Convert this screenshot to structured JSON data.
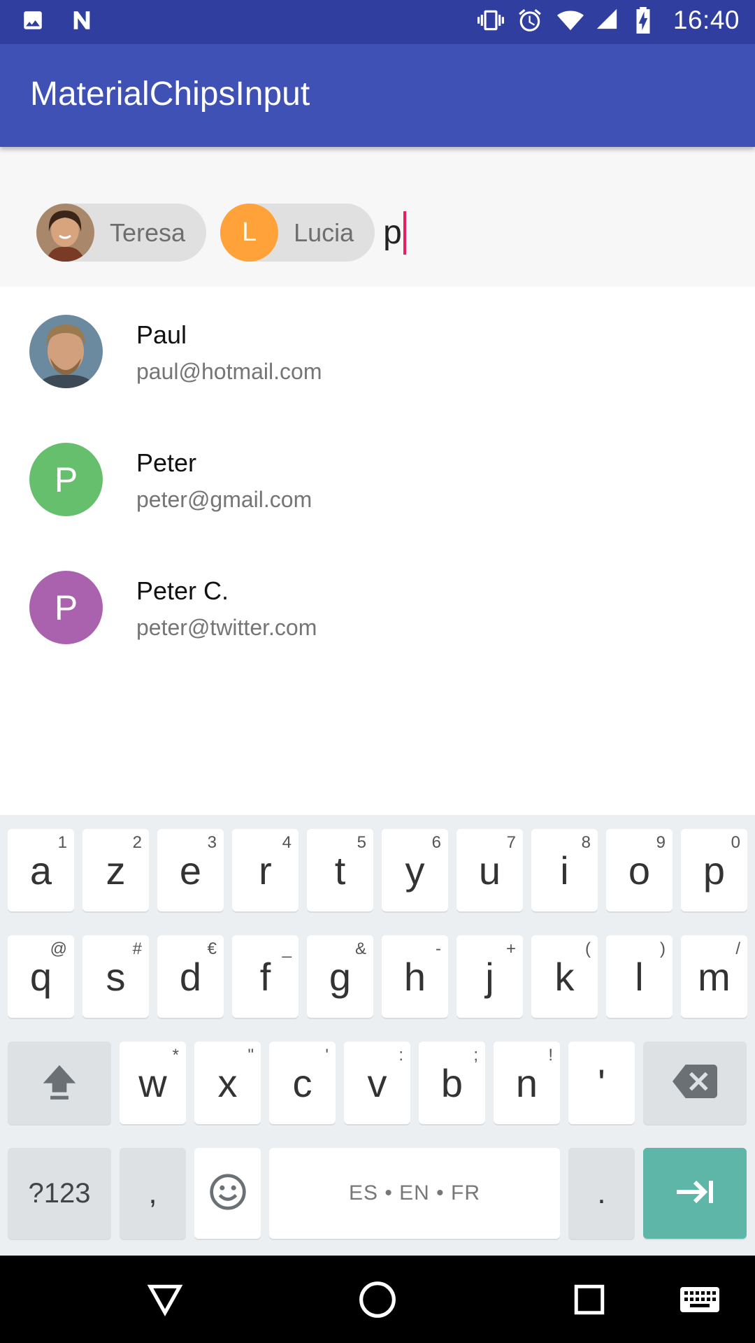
{
  "status_bar": {
    "time": "16:40",
    "left_icons": [
      "image-icon",
      "n-notification-icon"
    ],
    "right_icons": [
      "vibrate-icon",
      "alarm-icon",
      "wifi-icon",
      "signal-icon",
      "battery-charging-icon"
    ]
  },
  "app_bar": {
    "title": "MaterialChipsInput",
    "color": "#3f51b5",
    "status_color": "#303f9f"
  },
  "chips_input": {
    "chips": [
      {
        "label": "Teresa",
        "avatar": "photo"
      },
      {
        "label": "Lucia",
        "avatar_letter": "L",
        "avatar_color": "#ffa23a"
      }
    ],
    "typed_text": "p",
    "caret_color": "#e91e63"
  },
  "suggestions": [
    {
      "name": "Paul",
      "email": "paul@hotmail.com",
      "avatar": "photo"
    },
    {
      "name": "Peter",
      "email": "peter@gmail.com",
      "avatar_letter": "P",
      "avatar_color": "#66bf6d"
    },
    {
      "name": "Peter C.",
      "email": "peter@twitter.com",
      "avatar_letter": "P",
      "avatar_color": "#ab62ae"
    }
  ],
  "keyboard": {
    "row1": [
      {
        "k": "a",
        "h": "1"
      },
      {
        "k": "z",
        "h": "2"
      },
      {
        "k": "e",
        "h": "3"
      },
      {
        "k": "r",
        "h": "4"
      },
      {
        "k": "t",
        "h": "5"
      },
      {
        "k": "y",
        "h": "6"
      },
      {
        "k": "u",
        "h": "7"
      },
      {
        "k": "i",
        "h": "8"
      },
      {
        "k": "o",
        "h": "9"
      },
      {
        "k": "p",
        "h": "0"
      }
    ],
    "row2": [
      {
        "k": "q",
        "h": "@"
      },
      {
        "k": "s",
        "h": "#"
      },
      {
        "k": "d",
        "h": "€"
      },
      {
        "k": "f",
        "h": "_"
      },
      {
        "k": "g",
        "h": "&"
      },
      {
        "k": "h",
        "h": "-"
      },
      {
        "k": "j",
        "h": "+"
      },
      {
        "k": "k",
        "h": "("
      },
      {
        "k": "l",
        "h": ")"
      },
      {
        "k": "m",
        "h": "/"
      }
    ],
    "row3": [
      {
        "k": "w",
        "h": "*"
      },
      {
        "k": "x",
        "h": "\""
      },
      {
        "k": "c",
        "h": "'"
      },
      {
        "k": "v",
        "h": ":"
      },
      {
        "k": "b",
        "h": ";"
      },
      {
        "k": "n",
        "h": "!"
      },
      {
        "k": "'",
        "h": ""
      }
    ],
    "symbols_label": "?123",
    "comma_label": ",",
    "space_label": "ES • EN • FR",
    "period_label": ".",
    "accent_color": "#5db6a7"
  },
  "nav_bar": {
    "icons": [
      "back-icon",
      "home-icon",
      "recents-icon",
      "keyboard-icon"
    ]
  }
}
